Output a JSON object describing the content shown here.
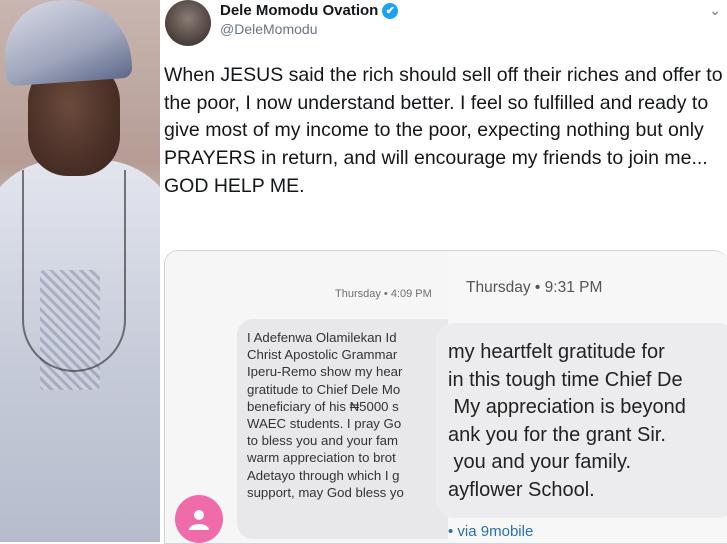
{
  "profile": {
    "display_name": "Dele Momodu Ovation",
    "handle": "@DeleMomodu",
    "verified_icon": "✔",
    "menu_icon": "⌄"
  },
  "tweet": {
    "text": "When JESUS said the rich should sell off their riches and offer to the poor, I now understand better. I feel so fulfilled and ready to give most of my income to the poor, expecting nothing but only PRAYERS in return, and will encourage my friends to join me... GOD HELP ME."
  },
  "attachment": {
    "left": {
      "timestamp": "Thursday • 4:09 PM",
      "message": "I Adefenwa Olamilekan Id\nChrist Apostolic Grammar\nIperu-Remo show my hear\ngratitude to Chief Dele Mo\nbeneficiary of his ₦5000 s\nWAEC students. I pray Go\nto bless you and your fam\nwarm appreciation to brot\nAdetayo through which I g\nsupport, may God bless yo"
    },
    "right": {
      "timestamp": "Thursday • 9:31 PM",
      "message": "my heartfelt gratitude for\nin this tough time Chief De\n My appreciation is beyond\nank you for the grant Sir.\n you and your family.\nayflower School.",
      "carrier": "• via 9mobile"
    }
  },
  "colors": {
    "verified_blue": "#1da1f2",
    "contact_pink": "#f06baa",
    "link_blue": "#2a6fb8"
  }
}
